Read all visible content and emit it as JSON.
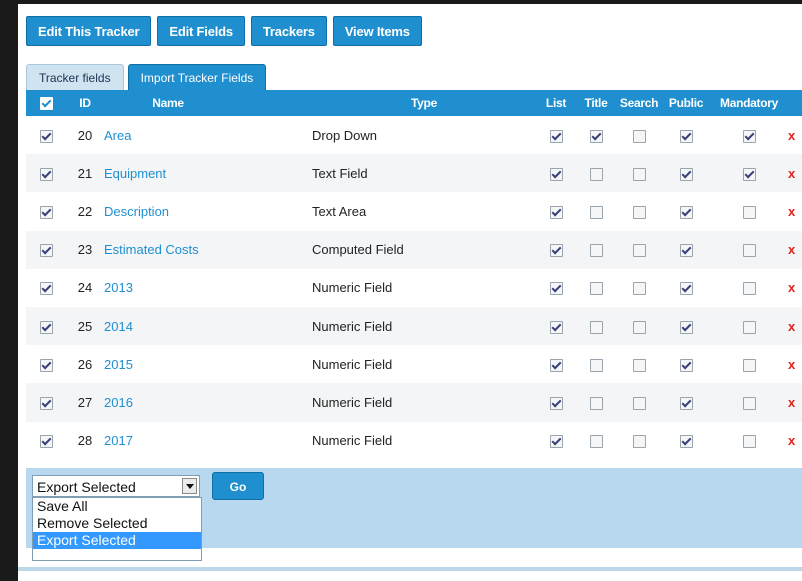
{
  "toolbar": {
    "buttons": [
      "Edit This Tracker",
      "Edit Fields",
      "Trackers",
      "View Items"
    ]
  },
  "tabs": [
    {
      "label": "Tracker fields",
      "active": true
    },
    {
      "label": "Import Tracker Fields",
      "active": false
    }
  ],
  "table": {
    "headers": {
      "id": "ID",
      "name": "Name",
      "type": "Type",
      "list": "List",
      "title": "Title",
      "search": "Search",
      "public": "Public",
      "mandatory": "Mandatory"
    },
    "select_all_checked": true,
    "rows": [
      {
        "id": "20",
        "name": "Area",
        "type": "Drop Down",
        "list": true,
        "title": true,
        "search": false,
        "public": true,
        "mandatory": true
      },
      {
        "id": "21",
        "name": "Equipment",
        "type": "Text Field",
        "list": true,
        "title": false,
        "search": false,
        "public": true,
        "mandatory": true
      },
      {
        "id": "22",
        "name": "Description",
        "type": "Text Area",
        "list": true,
        "title": false,
        "search": false,
        "public": true,
        "mandatory": false
      },
      {
        "id": "23",
        "name": "Estimated Costs",
        "type": "Computed Field",
        "list": true,
        "title": false,
        "search": false,
        "public": true,
        "mandatory": false
      },
      {
        "id": "24",
        "name": "2013",
        "type": "Numeric Field",
        "list": true,
        "title": false,
        "search": false,
        "public": true,
        "mandatory": false
      },
      {
        "id": "25",
        "name": "2014",
        "type": "Numeric Field",
        "list": true,
        "title": false,
        "search": false,
        "public": true,
        "mandatory": false
      },
      {
        "id": "26",
        "name": "2015",
        "type": "Numeric Field",
        "list": true,
        "title": false,
        "search": false,
        "public": true,
        "mandatory": false
      },
      {
        "id": "27",
        "name": "2016",
        "type": "Numeric Field",
        "list": true,
        "title": false,
        "search": false,
        "public": true,
        "mandatory": false
      },
      {
        "id": "28",
        "name": "2017",
        "type": "Numeric Field",
        "list": true,
        "title": false,
        "search": false,
        "public": true,
        "mandatory": false
      }
    ],
    "delete_icon": "x"
  },
  "actions": {
    "selected": "Export Selected",
    "options": [
      "Save All",
      "Remove Selected",
      "Export Selected"
    ],
    "go_label": "Go"
  },
  "colors": {
    "accent": "#1f8fcf",
    "panel": "#b7d8ee",
    "delete": "#e0231c",
    "highlight": "#3399ff"
  }
}
